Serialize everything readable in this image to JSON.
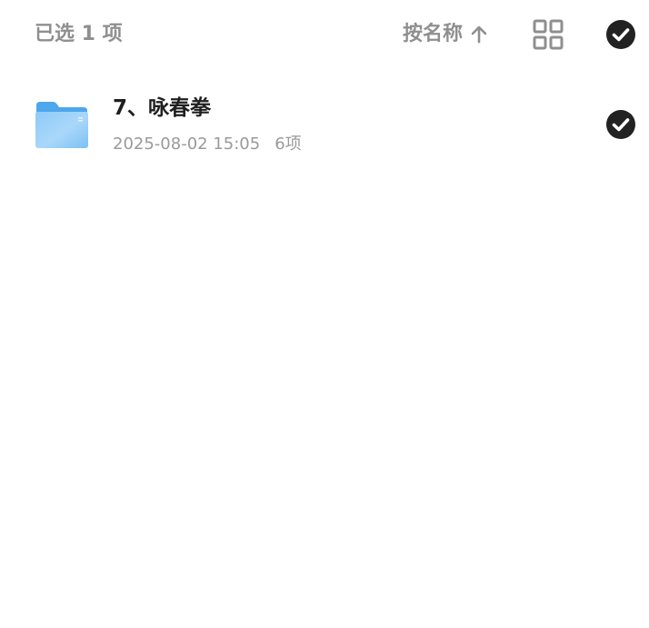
{
  "toolbar": {
    "selected_label": "已选 1 项",
    "sort_label": "按名称",
    "sort_direction_icon": "arrow-up-icon",
    "view_toggle_icon": "grid-view-icon",
    "select_all_icon": "check-circle-icon"
  },
  "files": [
    {
      "name": "7、咏春拳",
      "date": "2025-08-02 15:05",
      "count": "6项",
      "type_icon": "folder-icon",
      "selected": true
    }
  ],
  "colors": {
    "muted_text": "#8f8f8f",
    "title_text": "#1f1f1f",
    "check_fill": "#222222",
    "folder_blue": "#5aaef0"
  }
}
